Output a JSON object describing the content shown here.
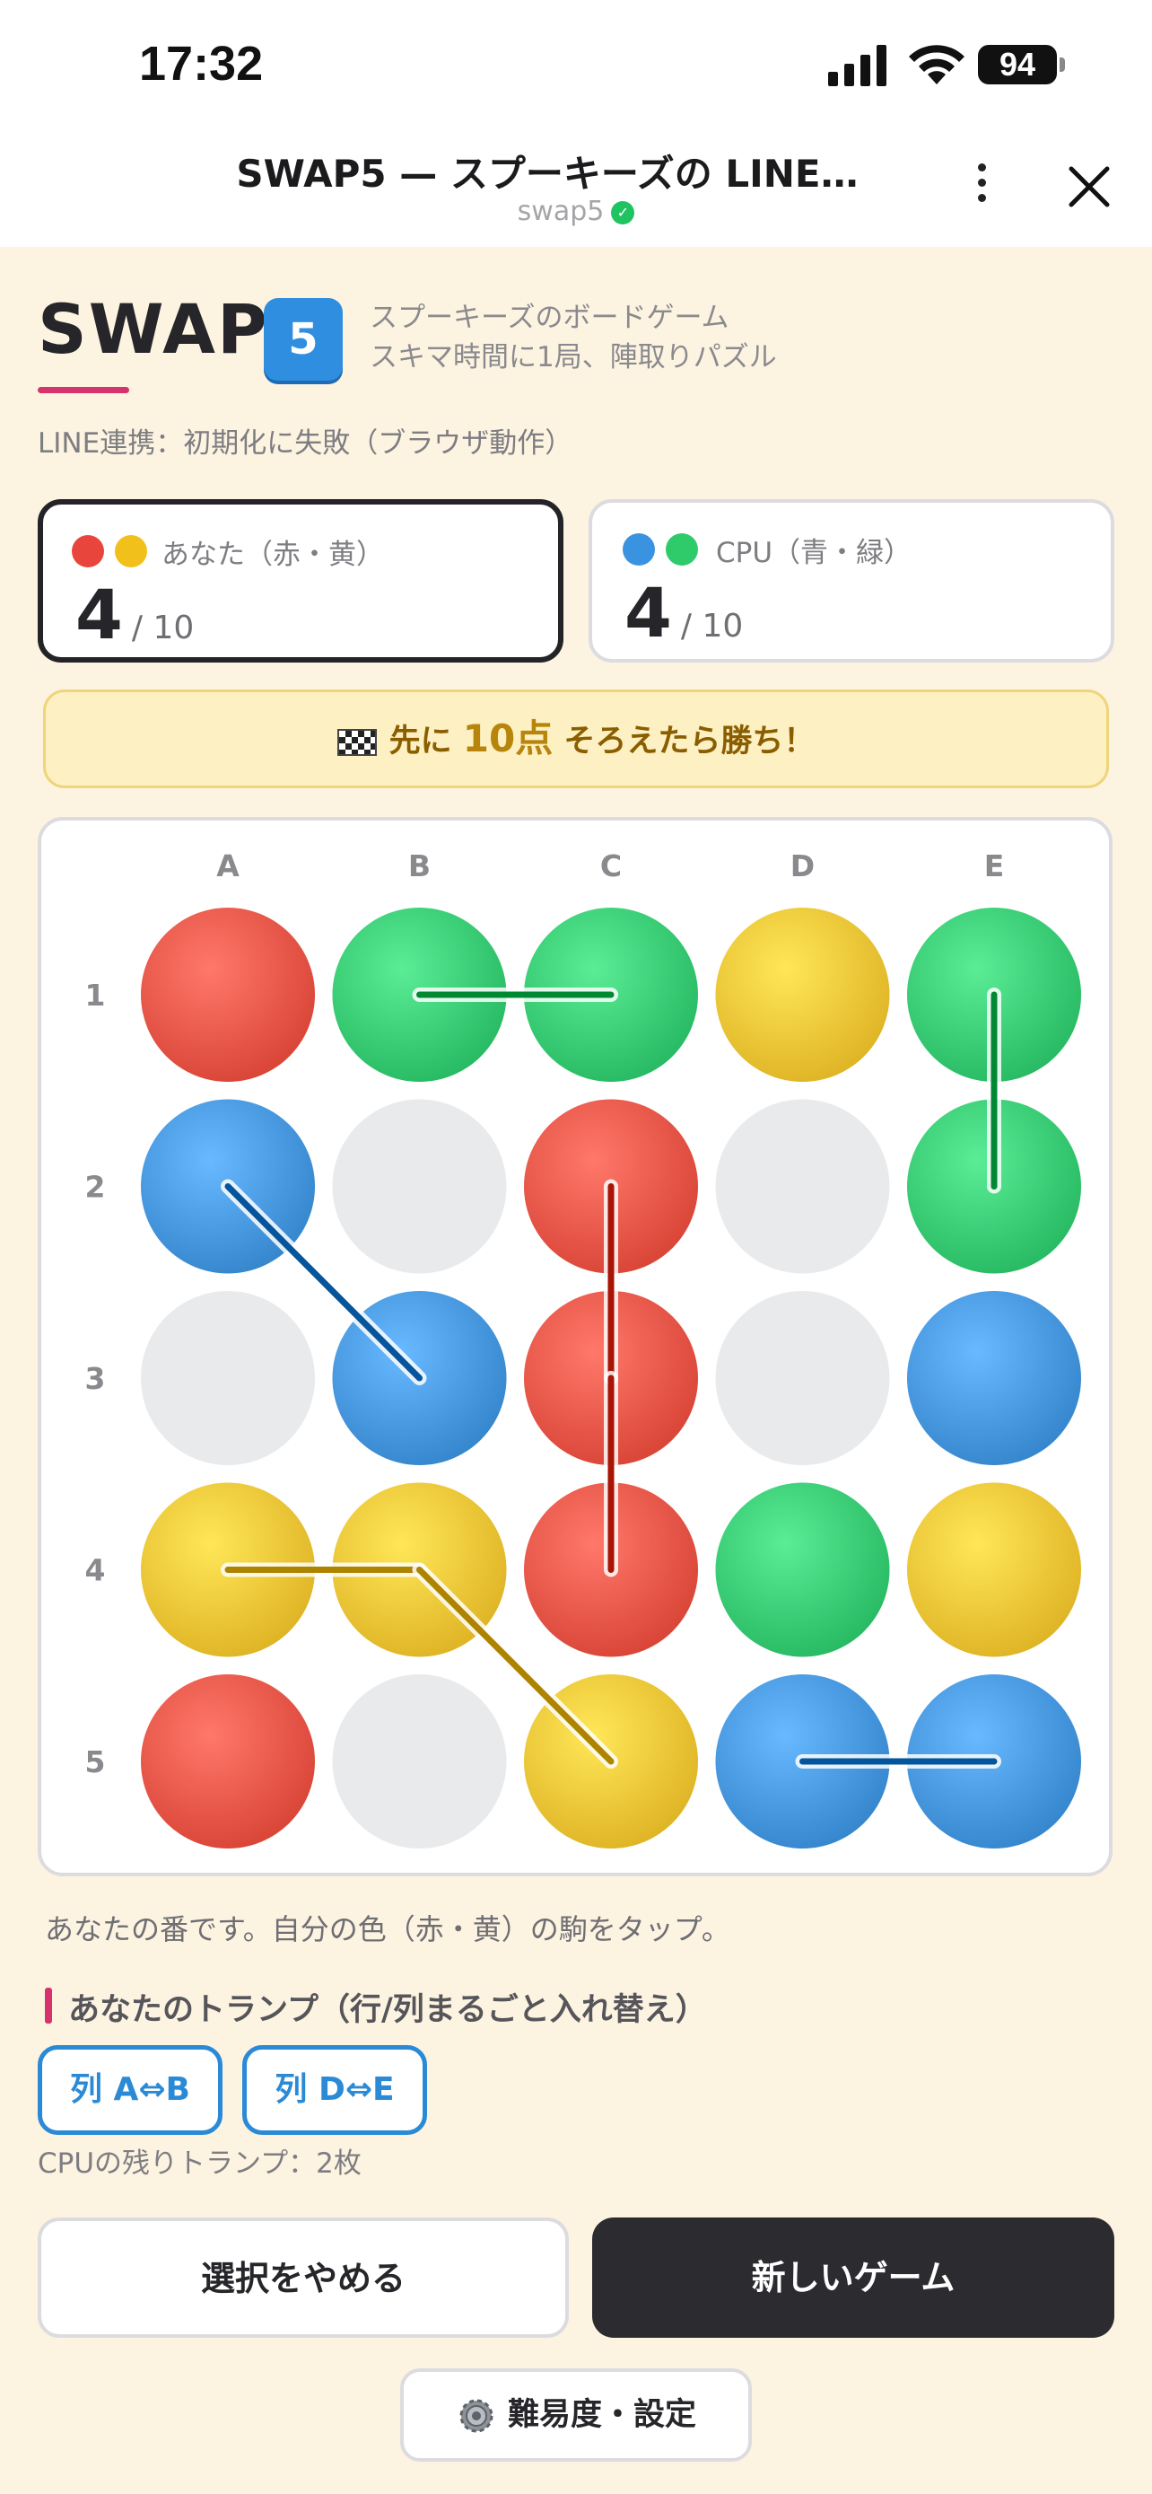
{
  "status_bar": {
    "time": "17:32",
    "battery": "94"
  },
  "title_bar": {
    "title": "SWAP5 — スプーキーズの LINE…",
    "subtitle": "swap5"
  },
  "header": {
    "logo": "SWAP",
    "logo_badge": "5",
    "tagline_1": "スプーキーズのボードゲーム",
    "tagline_2": "スキマ時間に1局、陣取りパズル",
    "line_status": "LINE連携：初期化に失敗（ブラウザ動作）"
  },
  "scores": {
    "you": {
      "label": "あなた（赤・黄）",
      "score": "4",
      "total": "/ 10",
      "colors": [
        "#e8463c",
        "#f2c01a"
      ]
    },
    "cpu": {
      "label": "CPU（青・緑）",
      "score": "4",
      "total": "/ 10",
      "colors": [
        "#3a93e0",
        "#2fcb6b"
      ]
    }
  },
  "goal": {
    "pre": "先に",
    "target": "10点",
    "post": "そろえたら勝ち！"
  },
  "board": {
    "columns": [
      "A",
      "B",
      "C",
      "D",
      "E"
    ],
    "rows": [
      "1",
      "2",
      "3",
      "4",
      "5"
    ],
    "cells": [
      [
        "red",
        "green",
        "green",
        "yellow",
        "green"
      ],
      [
        "blue",
        "empty",
        "red",
        "empty",
        "green"
      ],
      [
        "empty",
        "blue",
        "red",
        "empty",
        "blue"
      ],
      [
        "yellow",
        "yellow",
        "red",
        "green",
        "yellow"
      ],
      [
        "red",
        "empty",
        "yellow",
        "blue",
        "blue"
      ]
    ],
    "links": [
      {
        "from": "B1",
        "to": "C1",
        "color": "green"
      },
      {
        "from": "E1",
        "to": "E2",
        "color": "green"
      },
      {
        "from": "A2",
        "to": "B3",
        "color": "blue"
      },
      {
        "from": "C2",
        "to": "C3",
        "color": "red"
      },
      {
        "from": "C3",
        "to": "C4",
        "color": "red"
      },
      {
        "from": "A4",
        "to": "B4",
        "color": "yellow"
      },
      {
        "from": "B4",
        "to": "C5",
        "color": "yellow"
      },
      {
        "from": "D5",
        "to": "E5",
        "color": "blue"
      }
    ],
    "palette": {
      "red": "#ee5a4c",
      "green": "#3dcf78",
      "yellow": "#f4c93a",
      "blue": "#4a9be2",
      "empty": "#e9eaec"
    }
  },
  "turn_text": "あなたの番です。自分の色（赤・黄）の駒をタップ。",
  "trumps": {
    "title": "あなたのトランプ（行/列まるごと入れ替え）",
    "cards": [
      "列 A⇔B",
      "列 D⇔E"
    ],
    "cpu_remaining": "CPUの残りトランプ：2枚"
  },
  "actions": {
    "cancel": "選択をやめる",
    "new_game": "新しいゲーム",
    "settings": "難易度・設定"
  }
}
